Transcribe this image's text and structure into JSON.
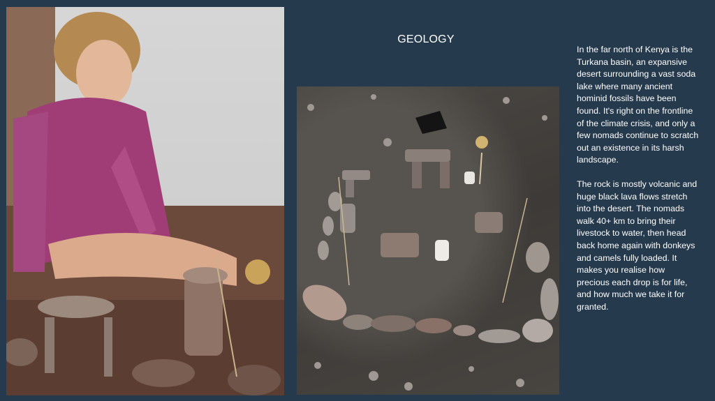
{
  "slide": {
    "title": "GEOLOGY",
    "paragraphs": [
      "In the far north of Kenya is the Turkana basin, an expansive desert surrounding a vast soda lake where many ancient hominid fossils have been found. It's right on the frontline of the climate crisis, and only a few nomads continue to scratch out an existence in its harsh landscape.",
      "The rock is mostly volcanic and huge black lava flows stretch into the desert. The nomads walk 40+ km to bring their livestock to water, then head back home again with donkeys and camels fully loaded. It makes you realise how precious each drop is for life, and how much we take it for granted."
    ]
  },
  "colors": {
    "background": "#263a4d",
    "text": "#ffffff"
  }
}
